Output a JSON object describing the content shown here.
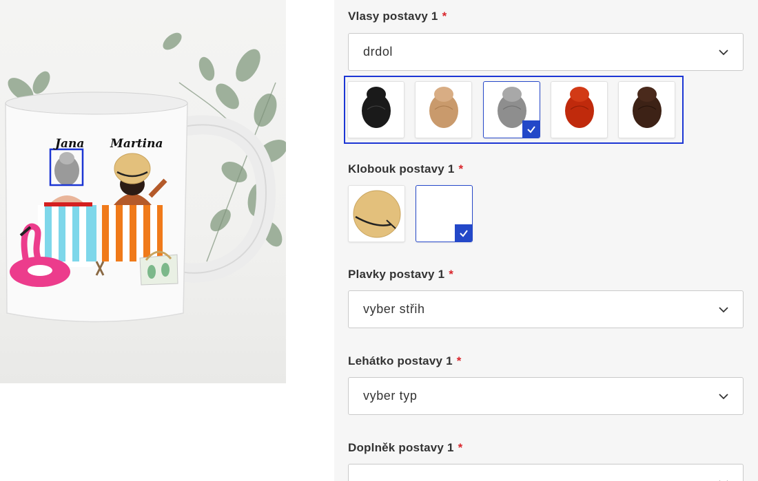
{
  "preview": {
    "names": [
      "Jana",
      "Martina"
    ]
  },
  "form": {
    "hair": {
      "label": "Vlasy postavy 1",
      "required_mark": "*",
      "value": "drdol",
      "swatches": [
        {
          "color": "black",
          "hex": "#1a1a1a",
          "selected": false
        },
        {
          "color": "blonde",
          "hex": "#c99a6c",
          "selected": false
        },
        {
          "color": "grey",
          "hex": "#8e8e8e",
          "selected": true
        },
        {
          "color": "red",
          "hex": "#c02a0c",
          "selected": false
        },
        {
          "color": "brown",
          "hex": "#3d2216",
          "selected": false
        }
      ]
    },
    "hat": {
      "label": "Klobouk postavy 1",
      "required_mark": "*",
      "options": [
        {
          "name": "straw-hat",
          "selected": false
        },
        {
          "name": "no-hat",
          "selected": true
        }
      ]
    },
    "swimsuit": {
      "label": "Plavky postavy 1",
      "required_mark": "*",
      "value": "vyber střih"
    },
    "lounger": {
      "label": "Lehátko postavy 1",
      "required_mark": "*",
      "value": "vyber typ"
    },
    "accessory": {
      "label": "Doplněk postavy 1",
      "required_mark": "*"
    }
  },
  "colors": {
    "accent": "#2348c8",
    "required": "#d9262c",
    "selection_outline": "#1b35d4"
  }
}
